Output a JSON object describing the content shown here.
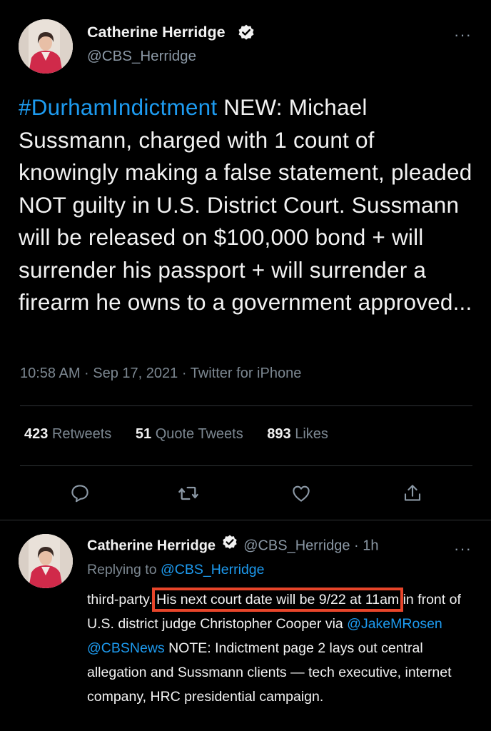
{
  "main_tweet": {
    "author_name": "Catherine Herridge",
    "author_handle": "@CBS_Herridge",
    "hashtag": "#DurhamIndictment",
    "body": " NEW: Michael Sussmann, charged with 1 count of knowingly making a false statement, pleaded NOT guilty in U.S. District Court. Sussmann will be released on $100,000 bond + will surrender his passport + will surrender a firearm he owns to a government approved...",
    "timestamp": "10:58 AM · Sep 17, 2021 · ",
    "source": "Twitter for iPhone",
    "stats": {
      "retweets_count": "423",
      "retweets_label": "Retweets",
      "quotes_count": "51",
      "quotes_label": "Quote Tweets",
      "likes_count": "893",
      "likes_label": "Likes"
    }
  },
  "reply_tweet": {
    "author_name": "Catherine Herridge",
    "author_handle": "@CBS_Herridge",
    "age": "· 1h",
    "replying_prefix": "Replying to ",
    "replying_handle": "@CBS_Herridge",
    "text_start": "third-party. ",
    "highlighted_text": "His next court date will be 9/22 at 11am",
    "text_mid": " in front of U.S. district judge Christopher Cooper via ",
    "mention_1": "@JakeMRosen",
    "mention_2": "@CBSNews",
    "text_end": " NOTE: Indictment page 2 lays out central allegation and Sussmann clients — tech executive, internet company, HRC presidential campaign."
  },
  "more_icon": "···",
  "colors": {
    "background": "#000000",
    "link": "#1d9bf0",
    "muted": "#7c8791",
    "highlight_box": "#e8452a"
  },
  "icons": [
    "verified-badge-icon",
    "more-icon",
    "reply-icon",
    "retweet-icon",
    "like-icon",
    "share-icon"
  ]
}
